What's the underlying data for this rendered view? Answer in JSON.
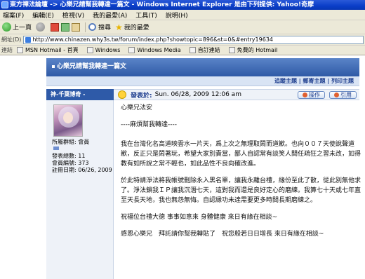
{
  "window": {
    "title": "東方禪法論壇 -> 心樂兄請幫我轉達一篇文 - Windows Internet Explorer 是由下列提供: Yahoo!奇摩"
  },
  "menu": {
    "items": [
      "檔案(F)",
      "編輯(E)",
      "檢視(V)",
      "我的最愛(A)",
      "工具(T)",
      "說明(H)"
    ]
  },
  "toolbar": {
    "back": "上一頁",
    "search": "搜尋",
    "favorites": "我的最愛"
  },
  "address": {
    "label": "網址(D)",
    "url": "http://www.chinazen.why3s.tw/forum/index.php?showtopic=896&st=0&#entry19634"
  },
  "links": {
    "label": "連結",
    "items": [
      "MSN Hotmail - 首頁",
      "Windows",
      "Windows Media",
      "自訂連結",
      "免費的 Hotmail"
    ]
  },
  "topic": {
    "title": "心樂兄請幫我轉達一篇文",
    "links": "追蹤主題 | 郵寄主題 | 列印主題"
  },
  "post": {
    "author": "神-千葉博奇 -",
    "posted_label": "發表於:",
    "date": "Sun. 06/28, 2009 12:06 am",
    "btn_ops": "操作",
    "btn_quote": "引用",
    "group": "所屬群組: 會員",
    "stats": [
      "發表總數: 11",
      "會員編號: 373",
      "註冊日期: 06/26, 2009"
    ],
    "greeting": "心樂兄法安",
    "subheading": "----麻煩幫我轉達----",
    "paragraphs": [
      "我在台灣化名高道映雲水一片天，爲上次之無理取鬧而道歉。也向００７天使說聲道歉，反正只是鬧著玩，希望大家別責當，鄙人自認常有談笑人間任疏狂之習未改，如得教有如所說之常不輕也，如此品性不良向確改進。",
      "於此特請淨法將我帳號刪除永入黑名單，讓我永離台禮，緣份至此了散，從此別無他求了。淨法鎖我ＩＰ讓我沉潛七天，這對我而還是良好定心的磨練。我算七十天或七年直至天長天地，我也無怨無悔。自認縁功未達需要更多時間長期磨練之。",
      "祝福位台禮大德 事事如意來 身體健康 來日有緣在相談~",
      "感恩心樂兄　拜託請你幫我轉貼了　祝您般若日日增長 來日有緣在相談~"
    ]
  }
}
